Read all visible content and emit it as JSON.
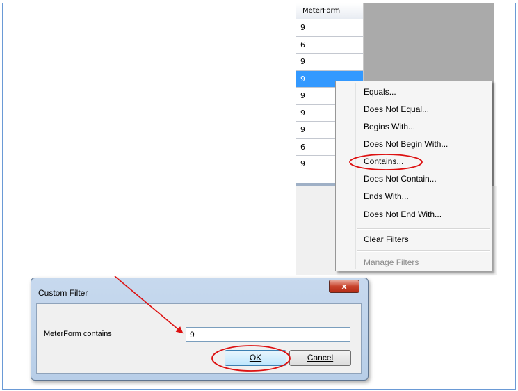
{
  "grid": {
    "header": "MeterForm",
    "rows": [
      "9",
      "6",
      "9",
      "9",
      "9",
      "9",
      "9",
      "6",
      "9"
    ]
  },
  "context_menu": {
    "items": {
      "equals": "Equals...",
      "does_not_equal": "Does Not Equal...",
      "begins_with": "Begins With...",
      "does_not_begin_with": "Does Not Begin With...",
      "contains": "Contains...",
      "does_not_contain": "Does Not Contain...",
      "ends_with": "Ends With...",
      "does_not_end_with": "Does Not End With...",
      "clear_filters": "Clear Filters",
      "manage_filters": "Manage Filters"
    }
  },
  "dialog": {
    "title": "Custom Filter",
    "close_glyph": "x",
    "label": "MeterForm contains",
    "input_value": "9",
    "ok_label": "OK",
    "cancel_label": "Cancel"
  },
  "colors": {
    "selection": "#3399ff",
    "annotation": "#dd1111",
    "frame": "#6a9ad6"
  }
}
